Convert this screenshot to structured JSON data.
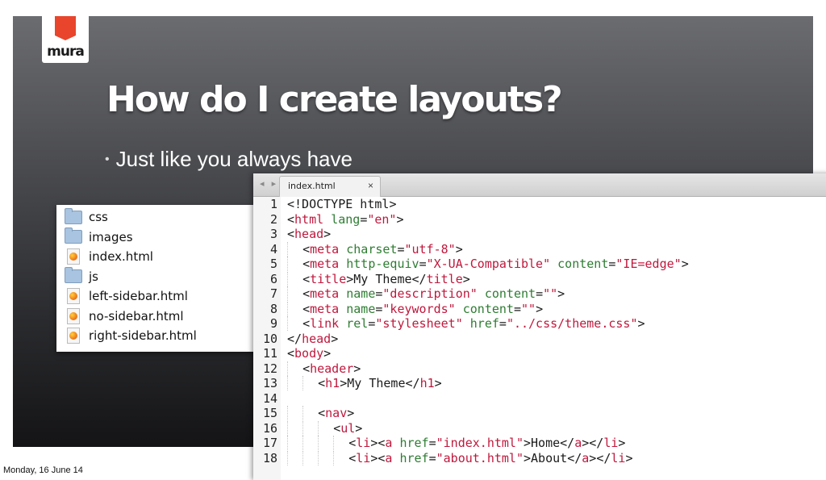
{
  "slide": {
    "title": "How do I create layouts?",
    "bullet": "Just like you always have",
    "logo": "mura",
    "date": "Monday, 16 June 14"
  },
  "finder": {
    "items": [
      {
        "name": "css",
        "icon": "folder-icon"
      },
      {
        "name": "images",
        "icon": "folder-icon"
      },
      {
        "name": "index.html",
        "icon": "firefox-html-icon"
      },
      {
        "name": "js",
        "icon": "folder-icon"
      },
      {
        "name": "left-sidebar.html",
        "icon": "firefox-html-icon"
      },
      {
        "name": "no-sidebar.html",
        "icon": "firefox-html-icon"
      },
      {
        "name": "right-sidebar.html",
        "icon": "firefox-html-icon"
      }
    ]
  },
  "editor": {
    "tab": "index.html",
    "close": "×",
    "nav_arrows": "◂ ▸",
    "lines": [
      "<!DOCTYPE html>",
      "<html lang=\"en\">",
      "<head>",
      "  <meta charset=\"utf-8\">",
      "  <meta http-equiv=\"X-UA-Compatible\" content=\"IE=edge\">",
      "  <title>My Theme</title>",
      "  <meta name=\"description\" content=\"\">",
      "  <meta name=\"keywords\" content=\"\">",
      "  <link rel=\"stylesheet\" href=\"../css/theme.css\">",
      "</head>",
      "<body>",
      "  <header>",
      "    <h1>My Theme</h1>",
      "",
      "    <nav>",
      "      <ul>",
      "        <li><a href=\"index.html\">Home</a></li>",
      "        <li><a href=\"about.html\">About</a></li>"
    ]
  },
  "colors": {
    "tag": "#c0183d",
    "attribute": "#2e7d32",
    "logo_accent": "#e8452c"
  }
}
